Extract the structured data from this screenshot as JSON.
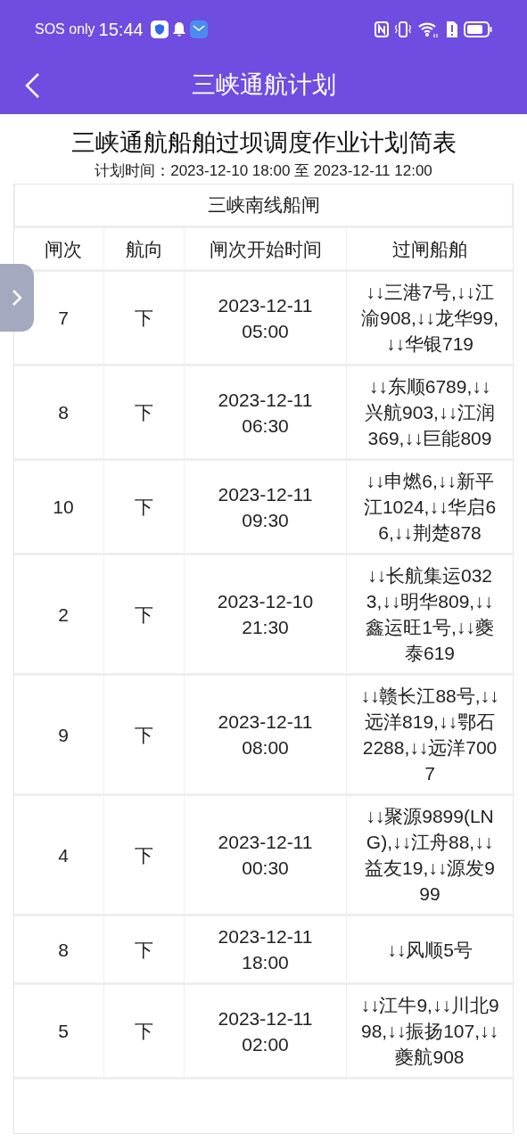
{
  "status_bar": {
    "carrier": "SOS only",
    "time": "15:44"
  },
  "header": {
    "title": "三峡通航计划"
  },
  "report": {
    "title": "三峡通航船舶过坝调度作业计划简表",
    "period": "计划时间：2023-12-10 18:00 至 2023-12-11 12:00"
  },
  "table": {
    "section": "三峡南线船闸",
    "columns": [
      "闸次",
      "航向",
      "闸次开始时间",
      "过闸船舶"
    ],
    "rows": [
      {
        "lock": "7",
        "direction": "下",
        "start": "2023-12-11 05:00",
        "ships": "↓↓三港7号,↓↓江渝908,↓↓龙华99,↓↓华银719"
      },
      {
        "lock": "8",
        "direction": "下",
        "start": "2023-12-11 06:30",
        "ships": "↓↓东顺6789,↓↓兴航903,↓↓江润369,↓↓巨能809"
      },
      {
        "lock": "10",
        "direction": "下",
        "start": "2023-12-11 09:30",
        "ships": "↓↓申燃6,↓↓新平江1024,↓↓华启66,↓↓荆楚878"
      },
      {
        "lock": "2",
        "direction": "下",
        "start": "2023-12-10 21:30",
        "ships": "↓↓长航集运0323,↓↓明华809,↓↓鑫运旺1号,↓↓夔泰619"
      },
      {
        "lock": "9",
        "direction": "下",
        "start": "2023-12-11 08:00",
        "ships": "↓↓赣长江88号,↓↓远洋819,↓↓鄂石2288,↓↓远洋7007"
      },
      {
        "lock": "4",
        "direction": "下",
        "start": "2023-12-11 00:30",
        "ships": "↓↓聚源9899(LNG),↓↓江舟88,↓↓益友19,↓↓源发999"
      },
      {
        "lock": "8",
        "direction": "下",
        "start": "2023-12-11 18:00",
        "ships": "↓↓风顺5号"
      },
      {
        "lock": "5",
        "direction": "下",
        "start": "2023-12-11 02:00",
        "ships": "↓↓江牛9,↓↓川北998,↓↓振扬107,↓↓夔航908"
      }
    ]
  }
}
